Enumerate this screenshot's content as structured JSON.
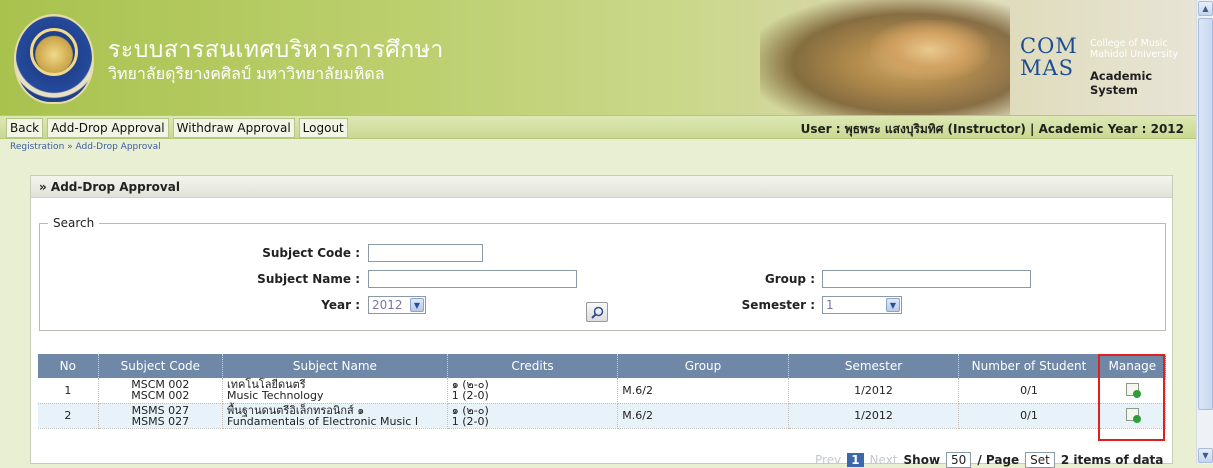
{
  "header": {
    "title_th": "ระบบสารสนเทศบริหารการศึกษา",
    "subtitle_th": "วิทยาลัยดุริยางคศิลป์ มหาวิทยาลัยมหิดล",
    "brand_com": "COM",
    "brand_mas": "MAS",
    "brand_college": "College of Music",
    "brand_university": "Mahidol University",
    "brand_system": "Academic System"
  },
  "menu": {
    "items": [
      "Back",
      "Add-Drop Approval",
      "Withdraw Approval",
      "Logout"
    ]
  },
  "user_info": "User : พุธพระ แสงบุริมทิศ (Instructor) | Academic Year : 2012",
  "breadcrumb": "Registration » Add-Drop Approval",
  "panel": {
    "title": "» Add-Drop Approval",
    "search_legend": "Search",
    "labels": {
      "subject_code": "Subject Code :",
      "subject_name": "Subject Name :",
      "year": "Year :",
      "group": "Group :",
      "semester": "Semester :"
    },
    "values": {
      "subject_code": "",
      "subject_name": "",
      "year": "2012",
      "group": "",
      "semester": "1"
    }
  },
  "table": {
    "headers": [
      "No",
      "Subject Code",
      "Subject Name",
      "Credits",
      "Group",
      "Semester",
      "Number of Student",
      "Manage"
    ],
    "rows": [
      {
        "no": "1",
        "code_a": "MSCM 002",
        "code_b": "MSCM 002",
        "name_a": "เทคโนโลยีดนตรี",
        "name_b": "Music Technology",
        "credit_a": "๑ (๒-๐)",
        "credit_b": "1 (2-0)",
        "group": "M.6/2",
        "semester": "1/2012",
        "students": "0/1"
      },
      {
        "no": "2",
        "code_a": "MSMS 027",
        "code_b": "MSMS 027",
        "name_a": "พื้นฐานดนตรีอิเล็กทรอนิกส์ ๑",
        "name_b": "Fundamentals of Electronic Music I",
        "credit_a": "๑ (๒-๐)",
        "credit_b": "1 (2-0)",
        "group": "M.6/2",
        "semester": "1/2012",
        "students": "0/1"
      }
    ]
  },
  "pager": {
    "prev": "Prev",
    "page": "1",
    "next": "Next",
    "show": "Show",
    "per_page": "50",
    "per_page_suffix": "/ Page",
    "set": "Set",
    "summary": "2 items of data"
  },
  "colors": {
    "header_green": "#a9c24e",
    "table_header": "#6f88a8",
    "highlight_red": "#e0201e",
    "link_blue": "#3b5e9e"
  }
}
